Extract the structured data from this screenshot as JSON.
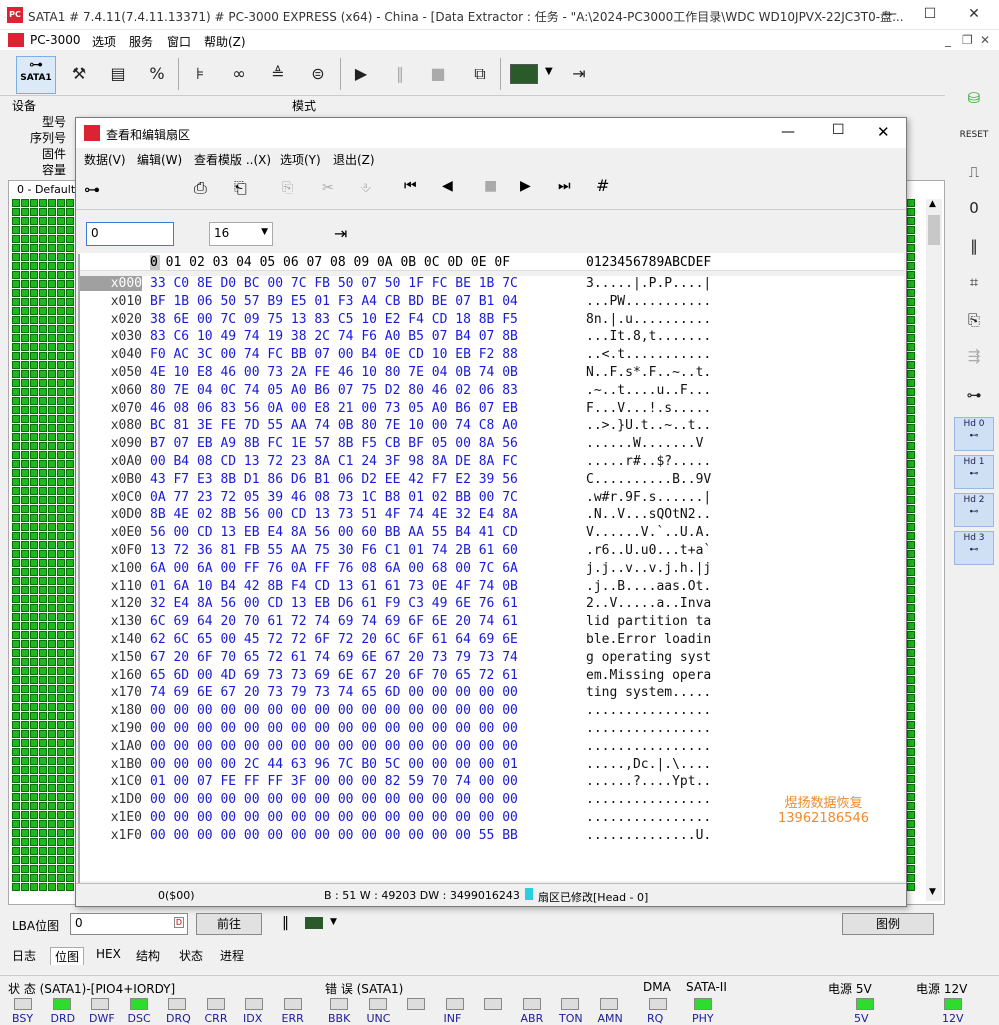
{
  "window": {
    "title": "SATA1 # 7.4.11(7.4.11.13371) # PC-3000 EXPRESS (x64) - China - [Data Extractor : 任务 - \"A:\\2024-PC3000工作目录\\WDC WD10JPVX-22JC3T0-盘..."
  },
  "menu": [
    "PC-3000",
    "选项",
    "服务",
    "窗口",
    "帮助(Z)"
  ],
  "toolbar": {
    "sata_label": "SATA1"
  },
  "device": {
    "section": "设备",
    "mode_section": "模式",
    "fields": [
      "型号",
      "序列号",
      "固件",
      "容量"
    ],
    "default_label": "0 - Default"
  },
  "dialog": {
    "title": "查看和编辑扇区",
    "menu": [
      "数据(V)",
      "编辑(W)",
      "查看模版 ..(X)",
      "选项(Y)",
      "退出(Z)"
    ],
    "offset_value": "0",
    "cols_value": "16",
    "header_hex": "0 01 02 03 04 05 06 07 08 09 0A 0B 0C 0D 0E 0F",
    "header_hex_first": "0",
    "header_ascii": "0123456789ABCDEF",
    "rows": [
      {
        "o": "x000",
        "h": "33 C0 8E D0 BC 00 7C FB 50 07 50 1F FC BE 1B 7C",
        "a": "3.....|.P.P....|"
      },
      {
        "o": "x010",
        "h": "BF 1B 06 50 57 B9 E5 01 F3 A4 CB BD BE 07 B1 04",
        "a": "...PW..........."
      },
      {
        "o": "x020",
        "h": "38 6E 00 7C 09 75 13 83 C5 10 E2 F4 CD 18 8B F5",
        "a": "8n.|.u.........."
      },
      {
        "o": "x030",
        "h": "83 C6 10 49 74 19 38 2C 74 F6 A0 B5 07 B4 07 8B",
        "a": "...It.8,t......."
      },
      {
        "o": "x040",
        "h": "F0 AC 3C 00 74 FC BB 07 00 B4 0E CD 10 EB F2 88",
        "a": "..<.t..........."
      },
      {
        "o": "x050",
        "h": "4E 10 E8 46 00 73 2A FE 46 10 80 7E 04 0B 74 0B",
        "a": "N..F.s*.F..~..t."
      },
      {
        "o": "x060",
        "h": "80 7E 04 0C 74 05 A0 B6 07 75 D2 80 46 02 06 83",
        "a": ".~..t....u..F..."
      },
      {
        "o": "x070",
        "h": "46 08 06 83 56 0A 00 E8 21 00 73 05 A0 B6 07 EB",
        "a": "F...V...!.s....."
      },
      {
        "o": "x080",
        "h": "BC 81 3E FE 7D 55 AA 74 0B 80 7E 10 00 74 C8 A0",
        "a": "..>.}U.t..~..t.."
      },
      {
        "o": "x090",
        "h": "B7 07 EB A9 8B FC 1E 57 8B F5 CB BF 05 00 8A 56",
        "a": "......W.......V"
      },
      {
        "o": "x0A0",
        "h": "00 B4 08 CD 13 72 23 8A C1 24 3F 98 8A DE 8A FC",
        "a": ".....r#..$?....."
      },
      {
        "o": "x0B0",
        "h": "43 F7 E3 8B D1 86 D6 B1 06 D2 EE 42 F7 E2 39 56",
        "a": "C..........B..9V"
      },
      {
        "o": "x0C0",
        "h": "0A 77 23 72 05 39 46 08 73 1C B8 01 02 BB 00 7C",
        "a": ".w#r.9F.s......|"
      },
      {
        "o": "x0D0",
        "h": "8B 4E 02 8B 56 00 CD 13 73 51 4F 74 4E 32 E4 8A",
        "a": ".N..V...sQOtN2.."
      },
      {
        "o": "x0E0",
        "h": "56 00 CD 13 EB E4 8A 56 00 60 BB AA 55 B4 41 CD",
        "a": "V......V.`..U.A."
      },
      {
        "o": "x0F0",
        "h": "13 72 36 81 FB 55 AA 75 30 F6 C1 01 74 2B 61 60",
        "a": ".r6..U.u0...t+a`"
      },
      {
        "o": "x100",
        "h": "6A 00 6A 00 FF 76 0A FF 76 08 6A 00 68 00 7C 6A",
        "a": "j.j..v..v.j.h.|j"
      },
      {
        "o": "x110",
        "h": "01 6A 10 B4 42 8B F4 CD 13 61 61 73 0E 4F 74 0B",
        "a": ".j..B....aas.Ot."
      },
      {
        "o": "x120",
        "h": "32 E4 8A 56 00 CD 13 EB D6 61 F9 C3 49 6E 76 61",
        "a": "2..V.....a..Inva"
      },
      {
        "o": "x130",
        "h": "6C 69 64 20 70 61 72 74 69 74 69 6F 6E 20 74 61",
        "a": "lid partition ta"
      },
      {
        "o": "x140",
        "h": "62 6C 65 00 45 72 72 6F 72 20 6C 6F 61 64 69 6E",
        "a": "ble.Error loadin"
      },
      {
        "o": "x150",
        "h": "67 20 6F 70 65 72 61 74 69 6E 67 20 73 79 73 74",
        "a": "g operating syst"
      },
      {
        "o": "x160",
        "h": "65 6D 00 4D 69 73 73 69 6E 67 20 6F 70 65 72 61",
        "a": "em.Missing opera"
      },
      {
        "o": "x170",
        "h": "74 69 6E 67 20 73 79 73 74 65 6D 00 00 00 00 00",
        "a": "ting system....."
      },
      {
        "o": "x180",
        "h": "00 00 00 00 00 00 00 00 00 00 00 00 00 00 00 00",
        "a": "................"
      },
      {
        "o": "x190",
        "h": "00 00 00 00 00 00 00 00 00 00 00 00 00 00 00 00",
        "a": "................"
      },
      {
        "o": "x1A0",
        "h": "00 00 00 00 00 00 00 00 00 00 00 00 00 00 00 00",
        "a": "................"
      },
      {
        "o": "x1B0",
        "h": "00 00 00 00 2C 44 63 96 7C B0 5C 00 00 00 00 01",
        "a": ".....,Dc.|.\\...."
      },
      {
        "o": "x1C0",
        "h": "01 00 07 FE FF FF 3F 00 00 00 82 59 70 74 00 00",
        "a": "......?....Ypt.."
      },
      {
        "o": "x1D0",
        "h": "00 00 00 00 00 00 00 00 00 00 00 00 00 00 00 00",
        "a": "................"
      },
      {
        "o": "x1E0",
        "h": "00 00 00 00 00 00 00 00 00 00 00 00 00 00 00 00",
        "a": "................"
      },
      {
        "o": "x1F0",
        "h": "00 00 00 00 00 00 00 00 00 00 00 00 00 00 55 BB",
        "a": "..............U."
      }
    ],
    "watermark": [
      "煜扬数据恢复",
      "13962186546"
    ],
    "status_offset": "0($00)",
    "status_info": "B : 51 W : 49203 DW : 3499016243",
    "status_modified": "扇区已修改[Head - 0]"
  },
  "lba": {
    "label": "LBA位图",
    "value": "0",
    "go_label": "前往",
    "legend_label": "图例"
  },
  "tabs": [
    "日志",
    "位图",
    "HEX",
    "结构",
    "状态",
    "进程"
  ],
  "status_bar": {
    "state_title": "状 态 (SATA1)-[PIO4+IORDY]",
    "error_title": "错 误 (SATA1)",
    "dma_title": "DMA",
    "sata_title": "SATA-II",
    "power5_title": "电源 5V",
    "power12_title": "电源 12V",
    "state_leds": [
      {
        "n": "BSY",
        "on": false
      },
      {
        "n": "DRD",
        "on": true
      },
      {
        "n": "DWF",
        "on": false
      },
      {
        "n": "DSC",
        "on": true
      },
      {
        "n": "DRQ",
        "on": false
      },
      {
        "n": "CRR",
        "on": false
      },
      {
        "n": "IDX",
        "on": false
      },
      {
        "n": "ERR",
        "on": false
      }
    ],
    "error_leds": [
      {
        "n": "BBK",
        "on": false
      },
      {
        "n": "UNC",
        "on": false
      },
      {
        "n": "",
        "on": false
      },
      {
        "n": "INF",
        "on": false
      },
      {
        "n": "",
        "on": false
      },
      {
        "n": "ABR",
        "on": false
      },
      {
        "n": "TON",
        "on": false
      },
      {
        "n": "AMN",
        "on": false
      }
    ],
    "dma_leds": [
      {
        "n": "RQ",
        "on": false
      }
    ],
    "sata_leds": [
      {
        "n": "PHY",
        "on": true
      }
    ],
    "power5_leds": [
      {
        "n": "5V",
        "on": true
      }
    ],
    "power12_leds": [
      {
        "n": "12V",
        "on": true
      }
    ]
  },
  "rightbar": {
    "hd_labels": [
      "Hd 0",
      "Hd 1",
      "Hd 2",
      "Hd 3"
    ]
  },
  "colors": {
    "led_on": "#2ddc2d",
    "hex_blue": "#1a1ad8",
    "watermark": "#f08a2a"
  }
}
